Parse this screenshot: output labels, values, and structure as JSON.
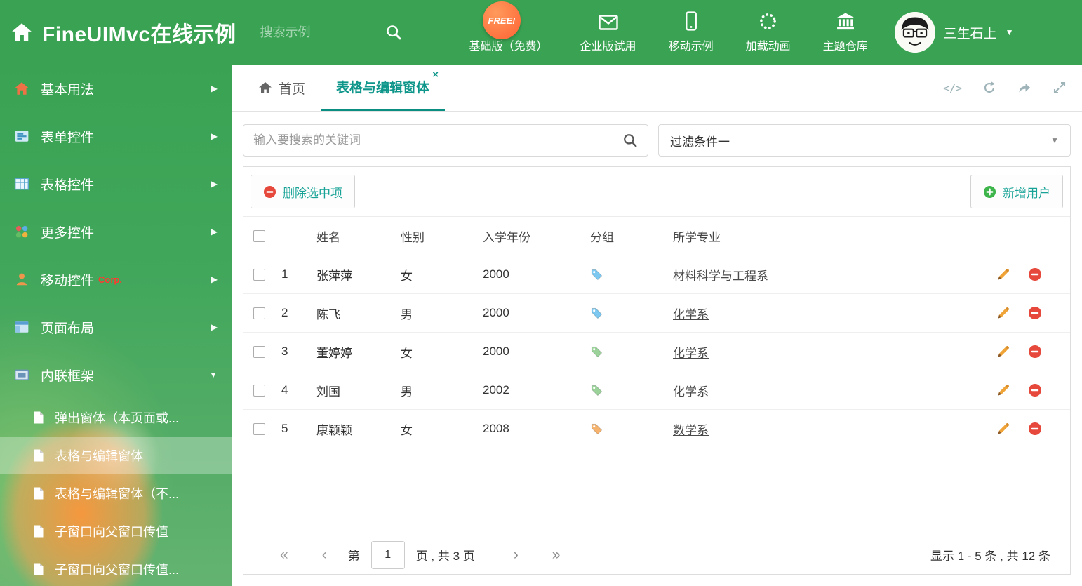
{
  "colors": {
    "header_green": "#3aa353",
    "accent_teal": "#0e968a",
    "tag_blue": "#7cc8f0",
    "tag_green": "#9ad29a",
    "tag_orange": "#f5b36e",
    "delete_red": "#e6493c",
    "add_green": "#3db54a",
    "pencil_orange": "#f0a437",
    "free_badge_orange": "#ff6233"
  },
  "icons": {
    "chevron_right": "▶",
    "chevron_down": "▼",
    "caret_down": "▼",
    "user_caret": "▼",
    "close": "×",
    "code": "</>",
    "pager_first": "«",
    "pager_prev": "‹",
    "pager_next": "›",
    "pager_last": "»"
  },
  "header": {
    "title": "FineUIMvc在线示例",
    "search_placeholder": "搜索示例",
    "free_badge": "FREE!",
    "nav": [
      {
        "label": "基础版（免费）",
        "icon": "download-icon"
      },
      {
        "label": "企业版试用",
        "icon": "mail-icon"
      },
      {
        "label": "移动示例",
        "icon": "mobile-icon"
      },
      {
        "label": "加载动画",
        "icon": "spinner-icon"
      },
      {
        "label": "主题仓库",
        "icon": "bank-icon"
      }
    ],
    "user_name": "三生石上"
  },
  "sidebar": {
    "items": [
      {
        "label": "基本用法"
      },
      {
        "label": "表单控件"
      },
      {
        "label": "表格控件"
      },
      {
        "label": "更多控件"
      },
      {
        "label": "移动控件",
        "badge": "Corp."
      },
      {
        "label": "页面布局"
      },
      {
        "label": "内联框架"
      }
    ],
    "subitems": [
      {
        "label": "弹出窗体（本页面或..."
      },
      {
        "label": "表格与编辑窗体"
      },
      {
        "label": "表格与编辑窗体（不..."
      },
      {
        "label": "子窗口向父窗口传值"
      },
      {
        "label": "子窗口向父窗口传值..."
      }
    ]
  },
  "tabs": {
    "home": "首页",
    "active": "表格与编辑窗体"
  },
  "filter": {
    "search_placeholder": "输入要搜索的关键词",
    "dropdown_value": "过滤条件一"
  },
  "grid": {
    "delete_button": "删除选中项",
    "add_button": "新增用户",
    "columns": {
      "name": "姓名",
      "gender": "性别",
      "year": "入学年份",
      "group": "分组",
      "major": "所学专业"
    },
    "rows": [
      {
        "num": "1",
        "name": "张萍萍",
        "gender": "女",
        "year": "2000",
        "tag": "blue",
        "major": "材料科学与工程系"
      },
      {
        "num": "2",
        "name": "陈飞",
        "gender": "男",
        "year": "2000",
        "tag": "blue",
        "major": "化学系"
      },
      {
        "num": "3",
        "name": "董婷婷",
        "gender": "女",
        "year": "2000",
        "tag": "green",
        "major": "化学系"
      },
      {
        "num": "4",
        "name": "刘国",
        "gender": "男",
        "year": "2002",
        "tag": "green",
        "major": "化学系"
      },
      {
        "num": "5",
        "name": "康颖颖",
        "gender": "女",
        "year": "2008",
        "tag": "orange",
        "major": "数学系"
      }
    ]
  },
  "pager": {
    "prefix": "第",
    "page_value": "1",
    "suffix": "页 , 共 3 页",
    "summary": "显示 1 - 5 条 , 共 12 条"
  }
}
